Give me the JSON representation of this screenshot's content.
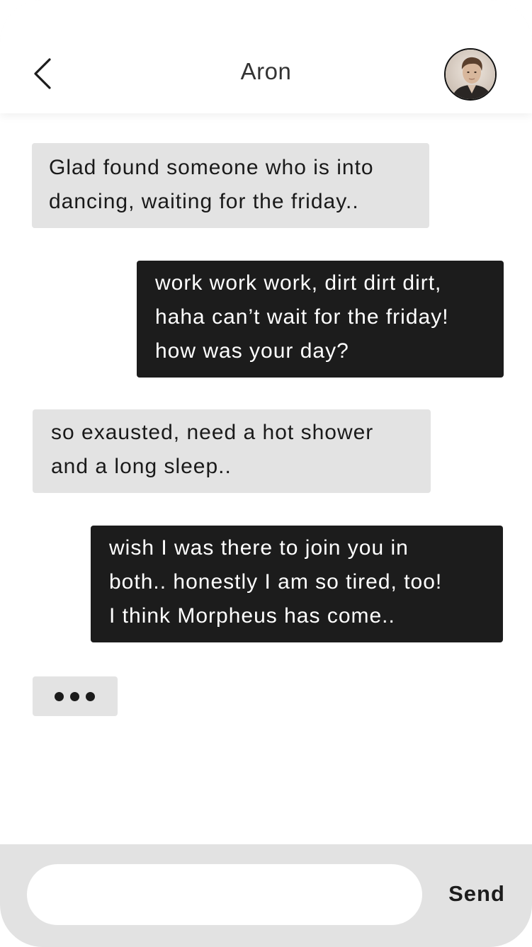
{
  "header": {
    "title": "Aron",
    "back_icon": "chevron-left-icon",
    "avatar_icon": "contact-avatar"
  },
  "messages": [
    {
      "from": "contact",
      "lines": [
        "Glad found someone who is into",
        "dancing, waiting for the friday.."
      ]
    },
    {
      "from": "me",
      "lines": [
        "work work work, dirt dirt dirt,",
        "haha can’t wait for the friday!",
        "how was your day?"
      ]
    },
    {
      "from": "contact",
      "lines": [
        "so exausted, need a hot shower",
        "and a long sleep.."
      ]
    },
    {
      "from": "me",
      "lines": [
        "wish I was there to join you in",
        "both.. honestly I am so tired, too!",
        "I think Morpheus has come.."
      ]
    }
  ],
  "typing_indicator": {
    "icon": "typing-dots-icon"
  },
  "composer": {
    "input_value": "",
    "input_placeholder": "",
    "send_label": "Send"
  },
  "colors": {
    "incoming_bubble": "#e3e3e3",
    "outgoing_bubble": "#1c1c1c",
    "composer_bg": "#e2e2e2"
  }
}
